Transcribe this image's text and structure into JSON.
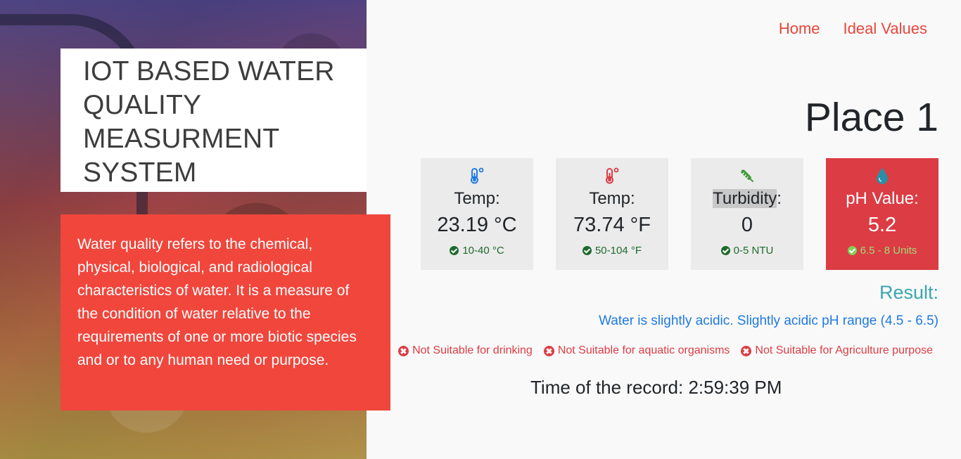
{
  "hero": {
    "title": "IOT BASED WATER QUALITY MEASURMENT SYSTEM",
    "description": "Water quality refers to the chemical, physical, biological, and radiological characteristics of water. It is a measure of the condition of water relative to the requirements of one or more biotic species and or to any human need or purpose."
  },
  "nav": {
    "home": "Home",
    "ideal_values": "Ideal Values"
  },
  "place": "Place 1",
  "cards": [
    {
      "icon": "thermometer-celsius-icon",
      "label": "Temp:",
      "value": "23.19 °C",
      "range": "10-40 °C",
      "status": "ok"
    },
    {
      "icon": "thermometer-fahrenheit-icon",
      "label": "Temp:",
      "value": "73.74 °F",
      "range": "50-104 °F",
      "status": "ok"
    },
    {
      "icon": "eyedropper-icon",
      "label_highlight": "Turbidity",
      "label_suffix": ":",
      "value": "0",
      "range": "0-5 NTU",
      "status": "ok"
    },
    {
      "icon": "water-drop-icon",
      "label": "pH Value:",
      "value": "5.2",
      "range": "6.5 - 8 Units",
      "status": "alert"
    }
  ],
  "result": {
    "label": "Result:",
    "text": "Water is slightly acidic. Slightly acidic pH range (4.5 - 6.5)",
    "warnings": [
      "Not Suitable for drinking",
      "Not Suitable for aquatic organisms",
      "Not Suitable for Agriculture purpose"
    ]
  },
  "record": {
    "text": "Time of the record: 2:59:39 PM"
  },
  "colors": {
    "accent_red": "#f0463c",
    "alert_red": "#dc3c44",
    "ok_green": "#1e6a2c",
    "result_teal": "#3aa6b0",
    "info_blue": "#1f7ae0"
  }
}
